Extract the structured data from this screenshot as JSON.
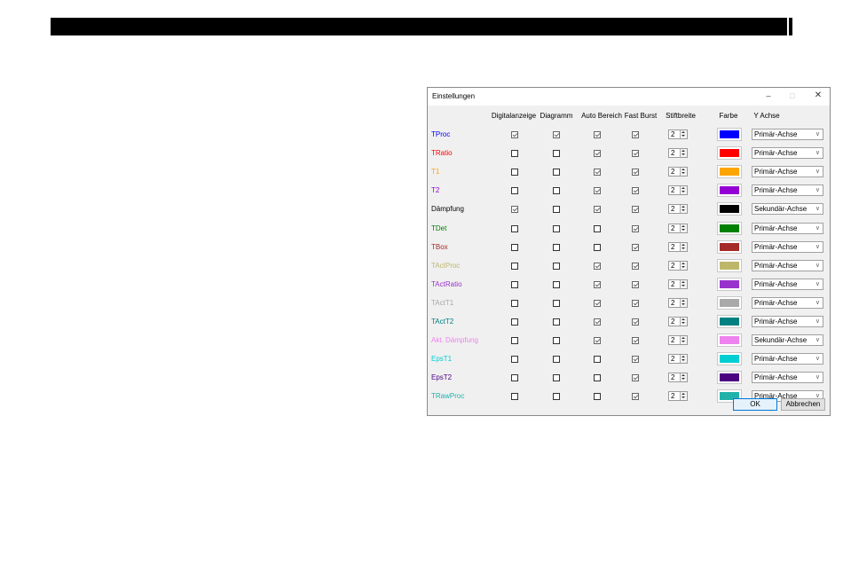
{
  "dialog": {
    "title": "Einstellungen",
    "min_glyph": "–",
    "max_glyph": "□",
    "close_glyph": "✕"
  },
  "headers": {
    "digital": "Digitalanzeige",
    "diagram": "Diagramm",
    "auto": "Auto Bereich",
    "fast": "Fast Burst",
    "pen": "Stiftbreite",
    "color": "Farbe",
    "axis": "Y Achse"
  },
  "rows": [
    {
      "label": "TProc",
      "label_color": "#0000ff",
      "digital": true,
      "diagram": true,
      "auto": true,
      "fast": true,
      "pen": "2",
      "color": "#0000ff",
      "axis": "Primär-Achse"
    },
    {
      "label": "TRatio",
      "label_color": "#ff0000",
      "digital": false,
      "diagram": false,
      "auto": true,
      "fast": true,
      "pen": "2",
      "color": "#ff0000",
      "axis": "Primär-Achse"
    },
    {
      "label": "T1",
      "label_color": "#ffa500",
      "digital": false,
      "diagram": false,
      "auto": true,
      "fast": true,
      "pen": "2",
      "color": "#ffa500",
      "axis": "Primär-Achse"
    },
    {
      "label": "T2",
      "label_color": "#9400d3",
      "digital": false,
      "diagram": false,
      "auto": true,
      "fast": true,
      "pen": "2",
      "color": "#9400d3",
      "axis": "Primär-Achse"
    },
    {
      "label": "Dämpfung",
      "label_color": "#000000",
      "digital": true,
      "diagram": false,
      "auto": true,
      "fast": true,
      "pen": "2",
      "color": "#000000",
      "axis": "Sekundär-Achse"
    },
    {
      "label": "TDet",
      "label_color": "#008000",
      "digital": false,
      "diagram": false,
      "auto": false,
      "fast": true,
      "pen": "2",
      "color": "#008000",
      "axis": "Primär-Achse"
    },
    {
      "label": "TBox",
      "label_color": "#a52a2a",
      "digital": false,
      "diagram": false,
      "auto": false,
      "fast": true,
      "pen": "2",
      "color": "#a52a2a",
      "axis": "Primär-Achse"
    },
    {
      "label": "TActProc",
      "label_color": "#bdb76b",
      "digital": false,
      "diagram": false,
      "auto": true,
      "fast": true,
      "pen": "2",
      "color": "#bdb76b",
      "axis": "Primär-Achse"
    },
    {
      "label": "TActRatio",
      "label_color": "#9932cc",
      "digital": false,
      "diagram": false,
      "auto": true,
      "fast": true,
      "pen": "2",
      "color": "#9932cc",
      "axis": "Primär-Achse"
    },
    {
      "label": "TActT1",
      "label_color": "#a9a9a9",
      "digital": false,
      "diagram": false,
      "auto": true,
      "fast": true,
      "pen": "2",
      "color": "#a9a9a9",
      "axis": "Primär-Achse"
    },
    {
      "label": "TActT2",
      "label_color": "#008080",
      "digital": false,
      "diagram": false,
      "auto": true,
      "fast": true,
      "pen": "2",
      "color": "#008080",
      "axis": "Primär-Achse"
    },
    {
      "label": "Akt. Dämpfung",
      "label_color": "#ee82ee",
      "digital": false,
      "diagram": false,
      "auto": true,
      "fast": true,
      "pen": "2",
      "color": "#ee82ee",
      "axis": "Sekundär-Achse"
    },
    {
      "label": "EpsT1",
      "label_color": "#00ced1",
      "digital": false,
      "diagram": false,
      "auto": false,
      "fast": true,
      "pen": "2",
      "color": "#00ced1",
      "axis": "Primär-Achse"
    },
    {
      "label": "EpsT2",
      "label_color": "#4b0082",
      "digital": false,
      "diagram": false,
      "auto": false,
      "fast": true,
      "pen": "2",
      "color": "#4b0082",
      "axis": "Primär-Achse"
    },
    {
      "label": "TRawProc",
      "label_color": "#20b2aa",
      "digital": false,
      "diagram": false,
      "auto": false,
      "fast": true,
      "pen": "2",
      "color": "#20b2aa",
      "axis": "Primär-Achse"
    }
  ],
  "buttons": {
    "ok": "OK",
    "cancel": "Abbrechen"
  }
}
